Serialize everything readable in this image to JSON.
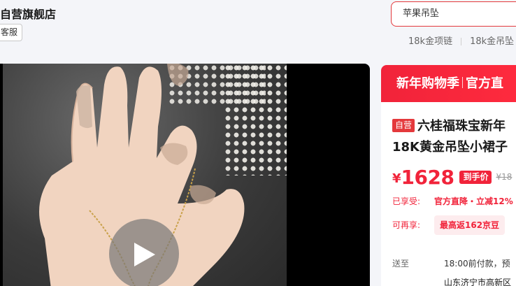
{
  "header": {
    "shop_name": "自营旗舰店",
    "service_label": "客服"
  },
  "search": {
    "query": "苹果吊坠",
    "hot_words": [
      "18k金项链",
      "18k金吊坠"
    ]
  },
  "media": {
    "play_icon": "play-icon"
  },
  "product": {
    "promo_banner_left": "新年购物季",
    "promo_banner_right": "官方直",
    "self_operated_tag": "自营",
    "title_line1": "六桂福珠宝新年",
    "title_line2": "18K黄金吊坠小裙子",
    "price_symbol": "¥",
    "price": "1628",
    "price_tag": "到手价",
    "original_price": "¥18",
    "enjoyed_label": "已享受:",
    "enjoyed_value": "官方直降・立减12%",
    "more_label": "可再享:",
    "more_value": "最高返162京豆",
    "ship_label": "送至",
    "ship_value": "18:00前付款，预",
    "address": "山东济宁市高新区"
  },
  "colors": {
    "accent": "#f1233a",
    "search_border": "#e4393c"
  }
}
